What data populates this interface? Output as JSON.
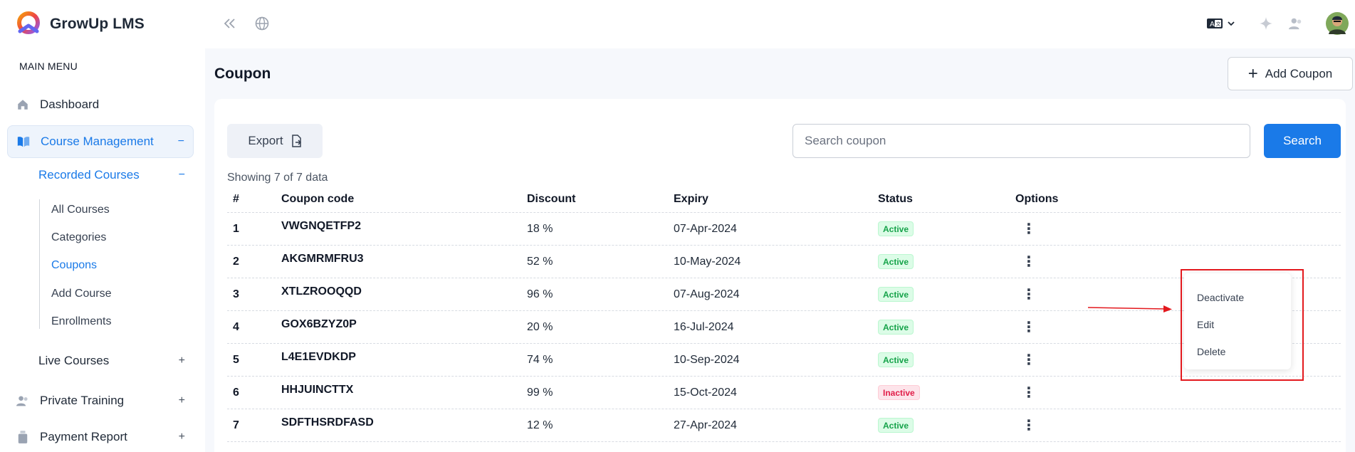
{
  "brand": {
    "name": "GrowUp LMS"
  },
  "sidebar": {
    "menu_title": "MAIN MENU",
    "dashboard": "Dashboard",
    "course_management": {
      "label": "Course Management",
      "toggle": "−"
    },
    "recorded_courses": {
      "label": "Recorded Courses",
      "toggle": "−"
    },
    "recorded_items": [
      "All Courses",
      "Categories",
      "Coupons",
      "Add Course",
      "Enrollments"
    ],
    "live_courses": {
      "label": "Live Courses",
      "toggle": "+"
    },
    "private_training": {
      "label": "Private Training",
      "toggle": "+"
    },
    "payment_report": {
      "label": "Payment Report",
      "toggle": "+"
    }
  },
  "page": {
    "title": "Coupon",
    "add_button": "Add Coupon",
    "add_icon": "+"
  },
  "toolbar": {
    "export_label": "Export",
    "search_placeholder": "Search coupon",
    "search_label": "Search",
    "showing": "Showing 7 of 7 data"
  },
  "table": {
    "headers": {
      "num": "#",
      "code": "Coupon code",
      "discount": "Discount",
      "expiry": "Expiry",
      "status": "Status",
      "options": "Options"
    },
    "rows": [
      {
        "num": "1",
        "code": "VWGNQETFP2",
        "discount": "18 %",
        "expiry": "07-Apr-2024",
        "status": "Active"
      },
      {
        "num": "2",
        "code": "AKGMRMFRU3",
        "discount": "52 %",
        "expiry": "10-May-2024",
        "status": "Active"
      },
      {
        "num": "3",
        "code": "XTLZROOQQD",
        "discount": "96 %",
        "expiry": "07-Aug-2024",
        "status": "Active"
      },
      {
        "num": "4",
        "code": "GOX6BZYZ0P",
        "discount": "20 %",
        "expiry": "16-Jul-2024",
        "status": "Active"
      },
      {
        "num": "5",
        "code": "L4E1EVDKDP",
        "discount": "74 %",
        "expiry": "10-Sep-2024",
        "status": "Active"
      },
      {
        "num": "6",
        "code": "HHJUINCTTX",
        "discount": "99 %",
        "expiry": "15-Oct-2024",
        "status": "Inactive"
      },
      {
        "num": "7",
        "code": "SDFTHSRDFASD",
        "discount": "12 %",
        "expiry": "27-Apr-2024",
        "status": "Active"
      }
    ],
    "kebab": "⋮"
  },
  "dropdown": {
    "items": [
      "Deactivate",
      "Edit",
      "Delete"
    ]
  },
  "colors": {
    "accent": "#1a7ae8",
    "active_badge": "#16a34a",
    "inactive_badge": "#e11d48",
    "annotation": "#e3191e"
  }
}
